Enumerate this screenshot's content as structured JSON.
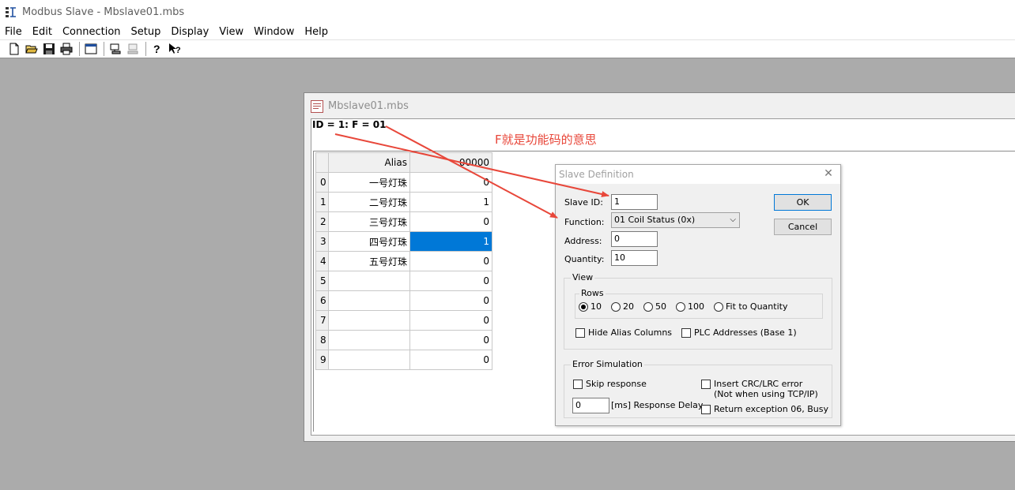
{
  "app": {
    "title": "Modbus Slave - Mbslave01.mbs"
  },
  "menu": [
    "File",
    "Edit",
    "Connection",
    "Setup",
    "Display",
    "View",
    "Window",
    "Help"
  ],
  "toolbar": {
    "icons": [
      "new-icon",
      "open-icon",
      "save-icon",
      "print-icon",
      "window-icon",
      "connect-icon",
      "disconnect-icon",
      "help-icon",
      "context-help-icon"
    ]
  },
  "child": {
    "title": "Mbslave01.mbs",
    "id_line": "ID = 1: F = 01",
    "grid": {
      "header_alias": "Alias",
      "header_value": "00000",
      "rows": [
        {
          "num": "0",
          "alias": "一号灯珠",
          "value": "0"
        },
        {
          "num": "1",
          "alias": "二号灯珠",
          "value": "1"
        },
        {
          "num": "2",
          "alias": "三号灯珠",
          "value": "0"
        },
        {
          "num": "3",
          "alias": "四号灯珠",
          "value": "1"
        },
        {
          "num": "4",
          "alias": "五号灯珠",
          "value": "0"
        },
        {
          "num": "5",
          "alias": "",
          "value": "0"
        },
        {
          "num": "6",
          "alias": "",
          "value": "0"
        },
        {
          "num": "7",
          "alias": "",
          "value": "0"
        },
        {
          "num": "8",
          "alias": "",
          "value": "0"
        },
        {
          "num": "9",
          "alias": "",
          "value": "0"
        }
      ],
      "selected_row": 3
    }
  },
  "annotation": {
    "text": "F就是功能码的意思",
    "color": "#e8473a"
  },
  "dialog": {
    "title": "Slave Definition",
    "slave_id_label": "Slave ID:",
    "slave_id_value": "1",
    "function_label": "Function:",
    "function_value": "01 Coil Status (0x)",
    "address_label": "Address:",
    "address_value": "0",
    "quantity_label": "Quantity:",
    "quantity_value": "10",
    "ok_label": "OK",
    "cancel_label": "Cancel",
    "view_group": "View",
    "rows_group": "Rows",
    "row_options": [
      "10",
      "20",
      "50",
      "100",
      "Fit to Quantity"
    ],
    "row_selected": "10",
    "hide_alias_label": "Hide Alias Columns",
    "plc_addresses_label": "PLC Addresses (Base 1)",
    "error_group": "Error Simulation",
    "skip_response_label": "Skip response",
    "insert_crc_label": "Insert CRC/LRC error",
    "insert_crc_note": "(Not when using TCP/IP)",
    "delay_value": "0",
    "delay_label": "[ms] Response Delay",
    "return_exception_label": "Return exception 06, Busy"
  }
}
